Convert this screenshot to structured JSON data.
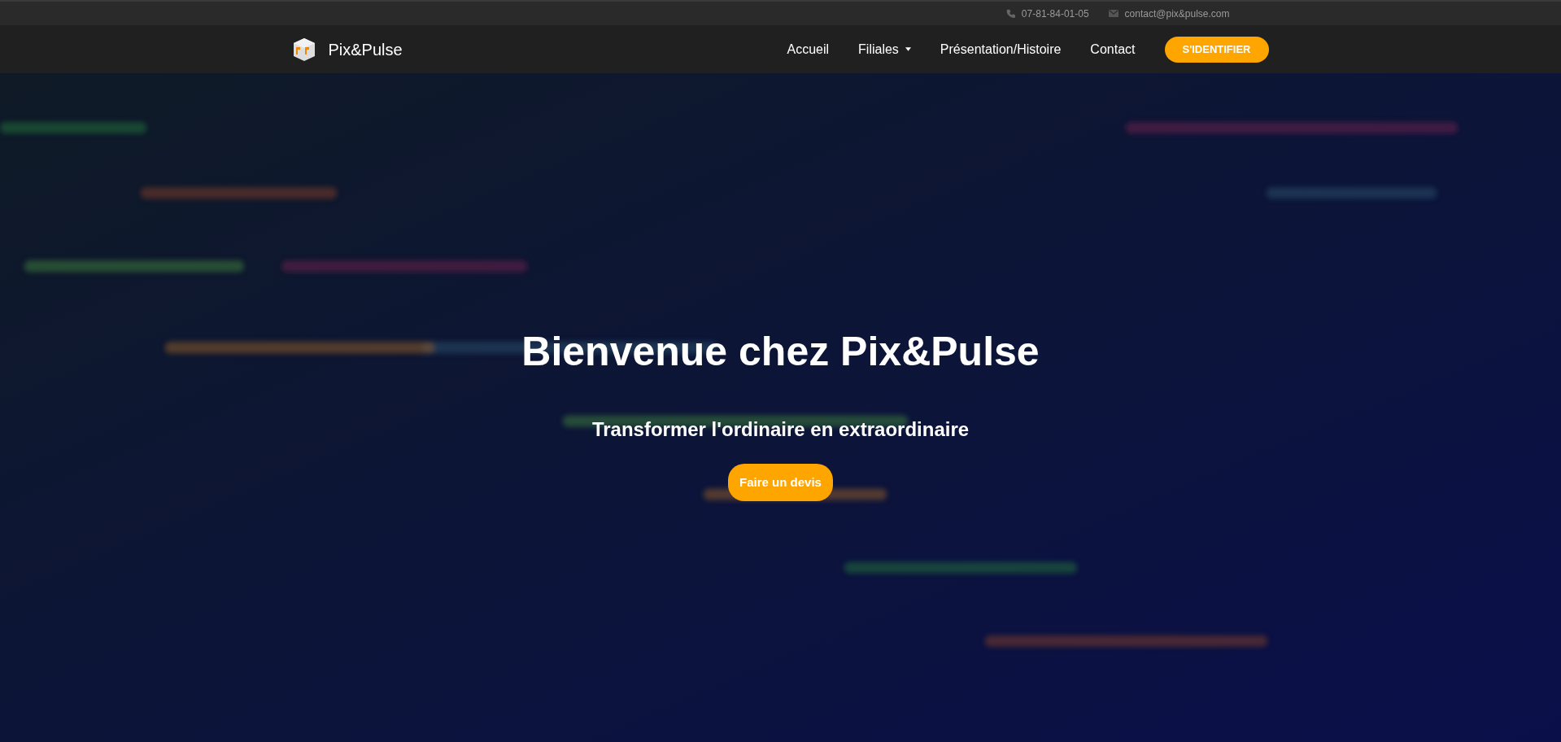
{
  "top_bar": {
    "phone": "07-81-84-01-05",
    "email": "contact@pix&pulse.com"
  },
  "navbar": {
    "brand": "Pix&Pulse",
    "links": [
      {
        "label": "Accueil",
        "kind": "link"
      },
      {
        "label": "Filiales",
        "kind": "dropdown"
      },
      {
        "label": "Présentation/Histoire",
        "kind": "link"
      },
      {
        "label": "Contact",
        "kind": "link"
      }
    ],
    "login_button": "S'IDENTIFIER"
  },
  "hero": {
    "title": "Bienvenue chez Pix&Pulse",
    "subtitle": "Transformer l'ordinaire en extraordinaire",
    "button": "Faire un devis"
  }
}
